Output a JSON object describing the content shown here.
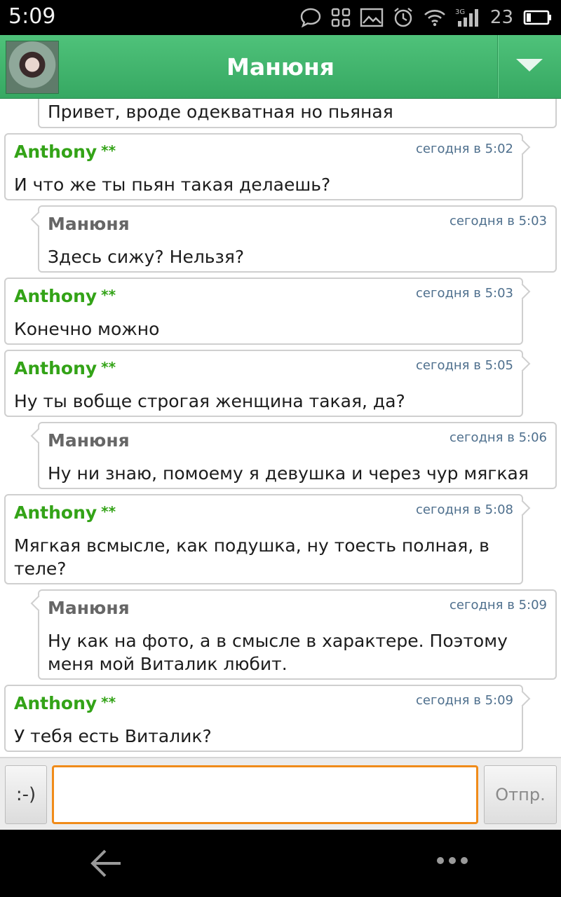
{
  "status_bar": {
    "time": "5:09",
    "network": "3G",
    "battery": "23",
    "icons": [
      "chat-bubble-icon",
      "grid-icon",
      "image-icon",
      "alarm-icon",
      "wifi-icon",
      "signal-icon",
      "battery-icon"
    ]
  },
  "header": {
    "title": "Манюня",
    "menu_icon": "dropdown-triangle-icon",
    "colors": {
      "bar": "#3fb46c"
    }
  },
  "messages": [
    {
      "from": "manyunya",
      "sender": "",
      "time": "",
      "text": "Привет, вроде одекватная но пьяная"
    },
    {
      "from": "anthony",
      "sender": "Anthony",
      "badge": "**",
      "time": "сегодня в 5:02",
      "text": "И что же ты пьян такая делаешь?"
    },
    {
      "from": "manyunya",
      "sender": "Манюня",
      "time": "сегодня в 5:03",
      "text": "Здесь сижу? Нельзя?"
    },
    {
      "from": "anthony",
      "sender": "Anthony",
      "badge": "**",
      "time": "сегодня в 5:03",
      "text": "Конечно можно"
    },
    {
      "from": "anthony",
      "sender": "Anthony",
      "badge": "**",
      "time": "сегодня в 5:05",
      "text": "Ну ты вобще строгая женщина такая, да?"
    },
    {
      "from": "manyunya",
      "sender": "Манюня",
      "time": "сегодня в 5:06",
      "text": "Ну ни знаю, помоему я девушка и через чур мягкая"
    },
    {
      "from": "anthony",
      "sender": "Anthony",
      "badge": "**",
      "time": "сегодня в 5:08",
      "text": "Мягкая всмысле, как подушка, ну тоесть полная, в теле?"
    },
    {
      "from": "manyunya",
      "sender": "Манюня",
      "time": "сегодня в 5:09",
      "text": "Ну как на фото, а в смысле в характере. Поэтому меня мой Виталик любит."
    },
    {
      "from": "anthony",
      "sender": "Anthony",
      "badge": "**",
      "time": "сегодня в 5:09",
      "text": "У тебя есть Виталик?"
    }
  ],
  "input_bar": {
    "smiley_label": ":-)",
    "input_value": "",
    "send_label": "Отпр.",
    "colors": {
      "input_border": "#f08b19"
    }
  },
  "nav_bar": {
    "back_icon": "back-arrow-icon",
    "more_icon": "more-dots-icon"
  }
}
